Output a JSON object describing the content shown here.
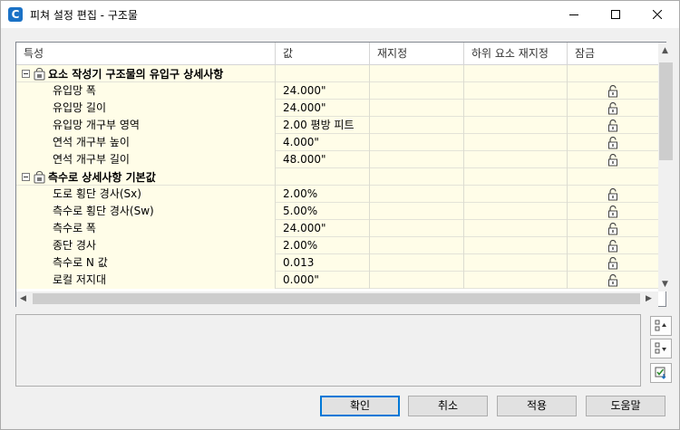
{
  "window": {
    "title": "피쳐 설정 편집 - 구조물",
    "app_icon_letter": "C"
  },
  "grid": {
    "columns": [
      "특성",
      "값",
      "재지정",
      "하위 요소 재지정",
      "잠금"
    ],
    "groups": [
      {
        "label": "요소 작성기 구조물의 유입구 상세사항",
        "rows": [
          {
            "property": "유입망 폭",
            "value": "24.000\""
          },
          {
            "property": "유입망 길이",
            "value": "24.000\""
          },
          {
            "property": "유입망 개구부 영역",
            "value": "2.00 평방 피트"
          },
          {
            "property": "연석 개구부 높이",
            "value": "4.000\""
          },
          {
            "property": "연석 개구부 길이",
            "value": "48.000\""
          }
        ]
      },
      {
        "label": "측수로 상세사항 기본값",
        "rows": [
          {
            "property": "도로 횡단 경사(Sx)",
            "value": "2.00%"
          },
          {
            "property": "측수로 횡단 경사(Sw)",
            "value": "5.00%"
          },
          {
            "property": "측수로 폭",
            "value": "24.000\""
          },
          {
            "property": "종단 경사",
            "value": "2.00%"
          },
          {
            "property": "측수로 N 값",
            "value": "0.013"
          },
          {
            "property": "로컬 저지대",
            "value": "0.000\""
          }
        ]
      }
    ]
  },
  "buttons": {
    "ok": "확인",
    "cancel": "취소",
    "apply": "적용",
    "help": "도움말"
  },
  "colors": {
    "row_bg": "#fffde8",
    "accent": "#0078d7"
  }
}
